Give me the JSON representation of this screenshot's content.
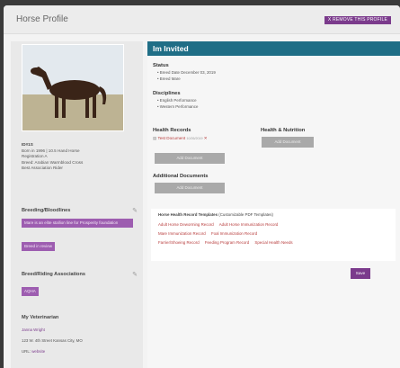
{
  "header": {
    "title": "Horse Profile",
    "remove_label": "X REMOVE THIS PROFILE"
  },
  "sidebar": {
    "stats": {
      "id": "ID#1S",
      "lines": [
        "Born in 1996 | 10.5 Hand Horse",
        "Registration A",
        "Breed: Arabian Warmblood Cross",
        "Best Association Rider"
      ]
    },
    "breeding": {
      "title": "Breeding/Bloodlines",
      "tag1": "Mare is an elite stallion line for Prosperity foundation",
      "tag2": "Breed in review"
    },
    "associations": {
      "title": "Breed/Riding Associations",
      "tag": "AQHA"
    },
    "vet": {
      "title": "My Veterinarian",
      "name": "Janna Wright",
      "address": "123 W. 4th Street Kansas City, MO",
      "web_label": "URL:",
      "web_link": "website"
    }
  },
  "main": {
    "invited": "Im Invited",
    "status": {
      "title": "Status",
      "items": [
        "Breed Date December 03, 2019",
        "Breed Mare"
      ]
    },
    "disciplines": {
      "title": "Disciplines",
      "items": [
        "English Performance",
        "Western Performance"
      ]
    },
    "health": {
      "title": "Health Records",
      "doc_label": "Test Document",
      "doc_date": "10/26/2019",
      "remove_mark": "✕",
      "add_label": "Add Document"
    },
    "nutrition": {
      "title": "Health & Nutrition",
      "add_label": "Add Document"
    },
    "additional": {
      "title": "Additional Documents",
      "add_label": "Add Document"
    },
    "templates": {
      "title": "Horse Health Record Templates",
      "subtitle": "(Customizable PDF Templates)",
      "row1": [
        "Adult Horse Deworming Record",
        "Adult Horse Immunization Record"
      ],
      "row2": [
        "Mare Immunization Record",
        "Foal Immunization Record"
      ],
      "row3": [
        "Farrier/Shoeing Record",
        "Feeding Program Record",
        "Special Health Needs"
      ]
    },
    "save_label": "Save"
  },
  "colors": {
    "accent": "#7b3b8c",
    "banner": "#1f6e86",
    "link": "#b73b3b"
  }
}
